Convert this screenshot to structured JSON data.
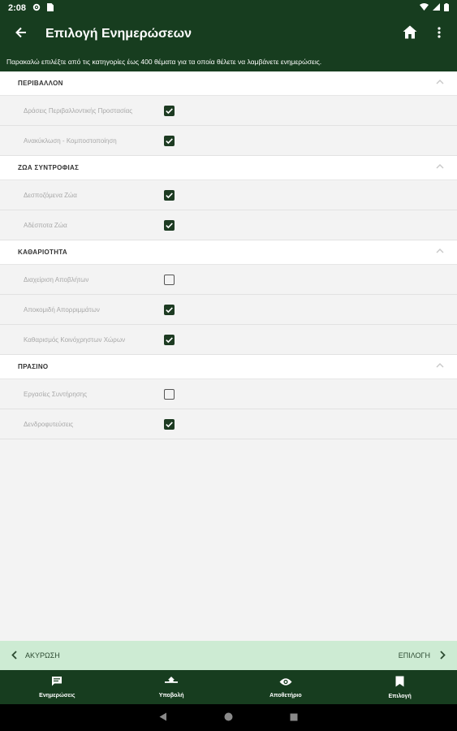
{
  "status_bar": {
    "time": "2:08",
    "icons": [
      "gear-icon",
      "sim-card-icon",
      "wifi-icon",
      "signal-icon",
      "battery-icon"
    ]
  },
  "app_bar": {
    "title": "Επιλογή Ενημερώσεων",
    "icons": [
      "back-arrow-icon",
      "home-icon",
      "more-vert-icon"
    ]
  },
  "instructions": "Παρακαλώ επιλέξτε από τις κατηγορίες έως 400 θέματα για τα οποία θέλετε να λαμβάνετε ενημερώσεις.",
  "sections": [
    {
      "title": "ΠΕΡΙΒΑΛΛΟΝ",
      "items": [
        {
          "label": "Δράσεις Περιβαλλοντικής Προστασίας",
          "checked": true
        },
        {
          "label": "Ανακύκλωση - Κομποστοποίηση",
          "checked": true
        }
      ]
    },
    {
      "title": "ΖΩΑ ΣΥΝΤΡΟΦΙΑΣ",
      "items": [
        {
          "label": "Δεσποζόμενα Ζώα",
          "checked": true
        },
        {
          "label": "Αδέσποτα Ζώα",
          "checked": true
        }
      ]
    },
    {
      "title": "ΚΑΘΑΡΙΟΤΗΤΑ",
      "items": [
        {
          "label": "Διαχείριση Αποβλήτων",
          "checked": false
        },
        {
          "label": "Αποκομιδή Απορριμμάτων",
          "checked": true
        },
        {
          "label": "Καθαρισμός Κοινόχρηστων Χώρων",
          "checked": true
        }
      ]
    },
    {
      "title": "ΠΡΑΣΙΝΟ",
      "items": [
        {
          "label": "Εργασίες Συντήρησης",
          "checked": false
        },
        {
          "label": "Δενδροφυτεύσεις",
          "checked": true
        }
      ]
    }
  ],
  "actions": {
    "cancel_label": "ΑΚΥΡΩΣΗ",
    "confirm_label": "ΕΠΙΛΟΓΗ"
  },
  "tabs": [
    {
      "label": "Ενημερώσεις",
      "icon": "message-icon"
    },
    {
      "label": "Υποβολή",
      "icon": "submit-icon"
    },
    {
      "label": "Αποθετήριο",
      "icon": "eye-icon"
    },
    {
      "label": "Επιλογή",
      "icon": "bookmark-icon"
    }
  ],
  "colors": {
    "primary": "#173d1f",
    "action_bar": "#cdebd3",
    "checkbox": "#1d3b22"
  }
}
